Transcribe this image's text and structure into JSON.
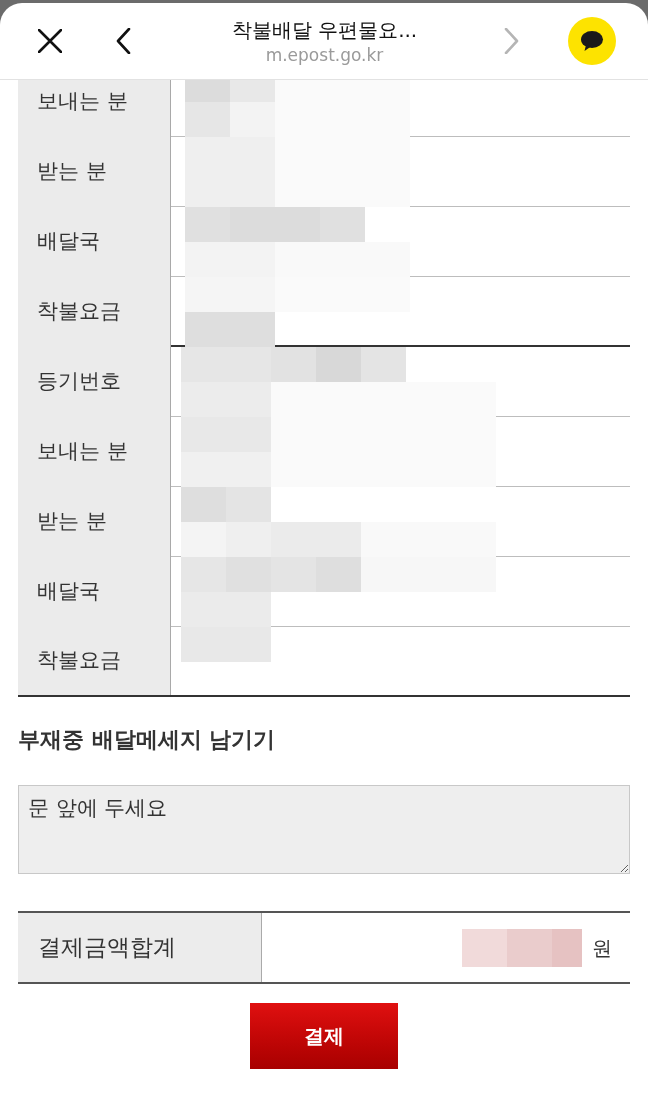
{
  "browser_bar": {
    "title": "착불배달 우편물요...",
    "url": "m.epost.go.kr",
    "forward_disabled": true
  },
  "parcels": [
    {
      "rows": [
        {
          "label": "보내는 분",
          "redacted": true
        },
        {
          "label": "받는 분",
          "redacted": true
        },
        {
          "label": "배달국",
          "redacted": true
        },
        {
          "label": "착불요금",
          "redacted": true
        }
      ]
    },
    {
      "rows": [
        {
          "label": "등기번호",
          "redacted": true
        },
        {
          "label": "보내는 분",
          "redacted": true
        },
        {
          "label": "받는 분",
          "redacted": true
        },
        {
          "label": "배달국",
          "redacted": true
        },
        {
          "label": "착불요금",
          "redacted": true
        }
      ]
    }
  ],
  "message_section": {
    "title": "부재중 배달메세지 남기기",
    "value": "문 앞에 두세요"
  },
  "total": {
    "label": "결제금액합계",
    "unit": "원",
    "redacted": true
  },
  "pay_button": "결제"
}
